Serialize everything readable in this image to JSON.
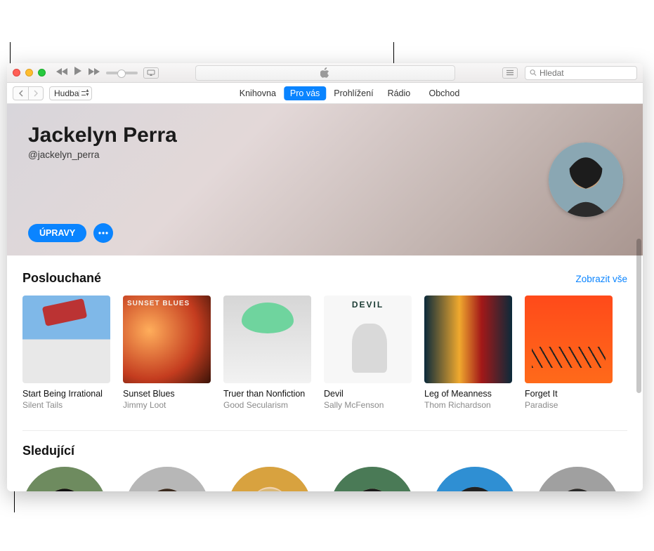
{
  "titlebar": {
    "now_playing_icon": "apple-logo"
  },
  "search": {
    "placeholder": "Hledat"
  },
  "library_selector": {
    "label": "Hudba"
  },
  "tabs": {
    "items": [
      {
        "label": "Knihovna",
        "active": false
      },
      {
        "label": "Pro vás",
        "active": true
      },
      {
        "label": "Prohlížení",
        "active": false
      },
      {
        "label": "Rádio",
        "active": false
      }
    ],
    "store_label": "Obchod"
  },
  "profile": {
    "name": "Jackelyn Perra",
    "handle": "@jackelyn_perra",
    "edit_label": "ÚPRAVY"
  },
  "listening": {
    "title": "Poslouchané",
    "see_all_label": "Zobrazit vše",
    "albums": [
      {
        "title": "Start Being Irrational",
        "artist": "Silent Tails"
      },
      {
        "title": "Sunset Blues",
        "artist": "Jimmy Loot"
      },
      {
        "title": "Truer than Nonfiction",
        "artist": "Good Secularism"
      },
      {
        "title": "Devil",
        "artist": "Sally McFenson"
      },
      {
        "title": "Leg of Meanness",
        "artist": "Thom Richardson"
      },
      {
        "title": "Forget It",
        "artist": "Paradise"
      }
    ]
  },
  "followers": {
    "title": "Sledující"
  }
}
